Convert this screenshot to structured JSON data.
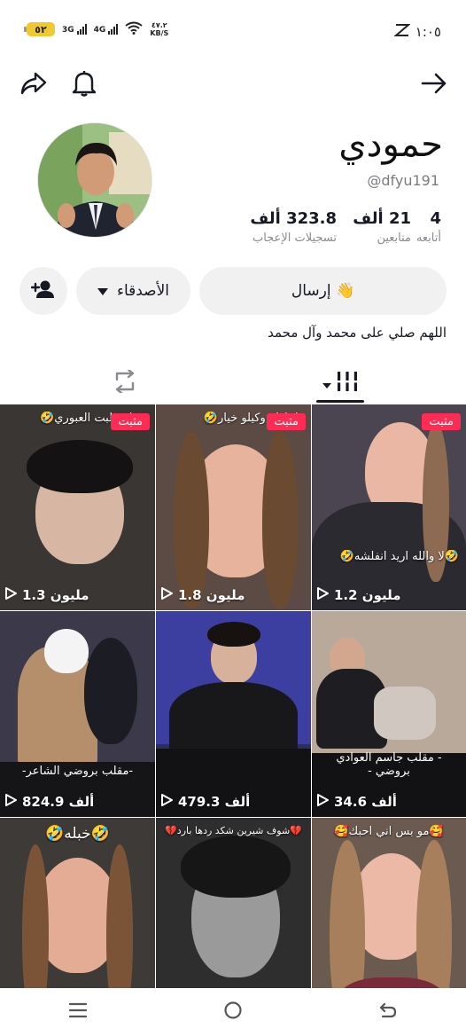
{
  "status_bar": {
    "battery": "٥٢",
    "net1": "3G",
    "net2": "4G",
    "speed_value": "٤٧.٢",
    "speed_unit": "KB/S",
    "time": "١:٠٥"
  },
  "profile": {
    "name": "حمودي",
    "handle": "@dfyu191",
    "stats": [
      {
        "value": "4",
        "label": "أتابعه"
      },
      {
        "value": "21 ألف",
        "label": "متابعين"
      },
      {
        "value": "323.8 ألف",
        "label": "تسجيلات الإعجاب"
      }
    ],
    "send_button": "إرسال 👋",
    "friends_button": "الأصدقاء",
    "bio": "اللهم صلي على محمد وآل محمد"
  },
  "videos": [
    {
      "caption": "بن انخطبت العبوري🤣",
      "pinned": "مثبت",
      "views": "1.3 مليون",
      "bg": "#3a3634"
    },
    {
      "caption": "طماطه وكيلو خيار🤣",
      "pinned": "مثبت",
      "views": "1.8 مليون",
      "bg": "#5c4a44"
    },
    {
      "caption": "🤣لا والله اريد انفلشه🤣",
      "pinned": "مثبت",
      "views": "1.2 مليون",
      "bg": "#4a4550"
    },
    {
      "caption": "",
      "pinned": "",
      "sub": "-مقلب بروضي الشاعر-",
      "views": "824.9 ألف",
      "bg": "#3c3a4a"
    },
    {
      "caption": "",
      "pinned": "",
      "sub": "",
      "views": "479.3 ألف",
      "bg": "#2b2f5a"
    },
    {
      "caption": "",
      "pinned": "",
      "sub": "- مقلب جاسم العوادي بروضي -",
      "views": "34.6 ألف",
      "bg": "#4d4846"
    },
    {
      "caption": "🤣خبله🤣",
      "pinned": "",
      "views": "",
      "bg": "#3e3a38"
    },
    {
      "caption": "💔شوف شيرين شكد ردها بارد💔",
      "pinned": "",
      "views": "",
      "bg": "#2e2e2e"
    },
    {
      "caption": "🥰مو بس اني احبك🥰",
      "pinned": "",
      "views": "",
      "bg": "#6b5a50"
    }
  ],
  "icons": {
    "share": "share-icon",
    "bell": "bell-icon",
    "back": "arrow-right-icon",
    "add_friend": "add-friend-icon",
    "grid_tab": "grid-icon",
    "repost_tab": "repost-icon"
  },
  "colors": {
    "accent": "#fe2c55",
    "button_bg": "#f1f1f2",
    "text": "#161823",
    "muted": "#8a8b91"
  }
}
